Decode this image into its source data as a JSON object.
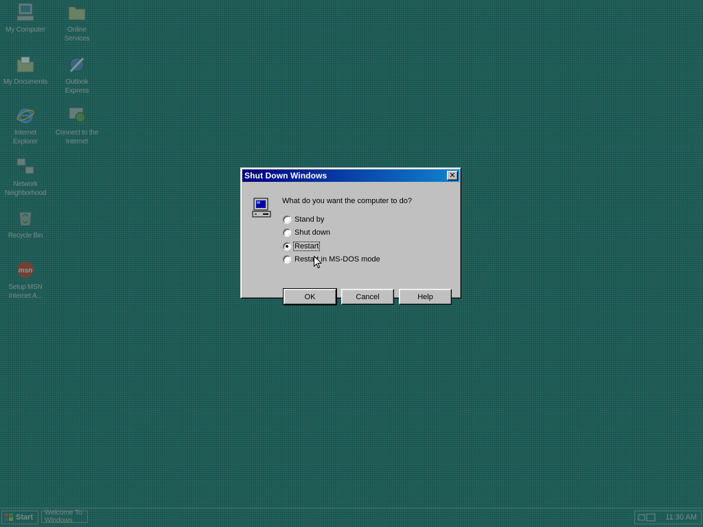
{
  "desktop": {
    "icons": [
      {
        "label": "My Computer",
        "icon": "my-computer-icon"
      },
      {
        "label": "Online\nServices",
        "icon": "folder-icon"
      },
      {
        "label": "My Documents",
        "icon": "documents-folder-icon"
      },
      {
        "label": "Outlook\nExpress",
        "icon": "outlook-express-icon"
      },
      {
        "label": "Internet\nExplorer",
        "icon": "internet-explorer-icon"
      },
      {
        "label": "Connect to the\nInternet",
        "icon": "connection-wizard-icon"
      },
      {
        "label": "Network\nNeighborhood",
        "icon": "network-icon"
      },
      {
        "label": "Recycle Bin",
        "icon": "recycle-bin-icon"
      },
      {
        "label": "Setup MSN\nInternet A...",
        "icon": "msn-icon"
      }
    ]
  },
  "dialog": {
    "title": "Shut Down Windows",
    "close_glyph": "✕",
    "question": "What do you want the computer to do?",
    "options": [
      {
        "label": "Stand by",
        "selected": false
      },
      {
        "label": "Shut down",
        "selected": false
      },
      {
        "label": "Restart",
        "selected": true
      },
      {
        "label": "Restart in MS-DOS mode",
        "selected": false
      }
    ],
    "buttons": {
      "ok": "OK",
      "cancel": "Cancel",
      "help": "Help"
    }
  },
  "taskbar": {
    "start_label": "Start",
    "task_label": "Welcome To Windows",
    "clock": "11:30 AM"
  },
  "colors": {
    "desktop": "#1f5b56",
    "titlebar_start": "#000080",
    "titlebar_end": "#1084d0",
    "face": "#c0c0c0"
  }
}
